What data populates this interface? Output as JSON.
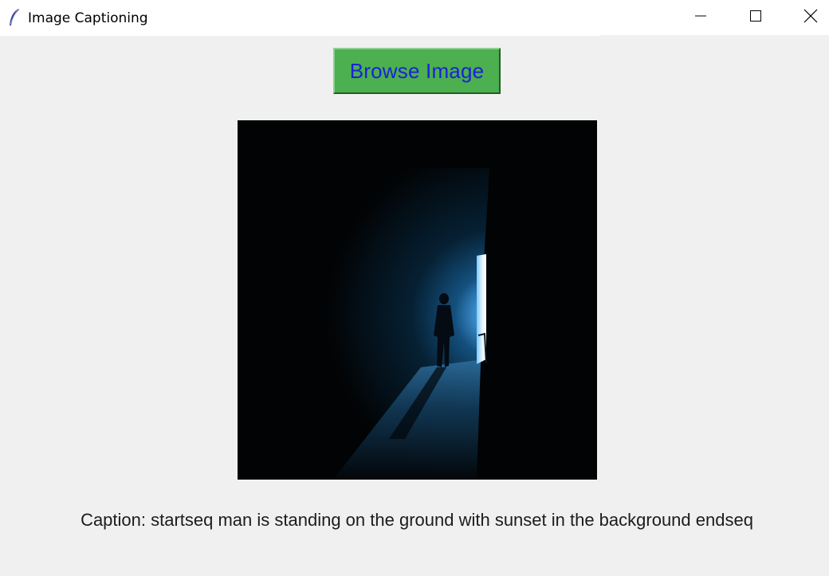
{
  "window": {
    "title": "Image Captioning",
    "icon": "feather-icon",
    "controls": [
      "minimize-icon",
      "maximize-icon",
      "close-icon"
    ]
  },
  "toolbar": {
    "browse_label": "Browse Image"
  },
  "image": {
    "description_icon": "photo-dark-corridor-silhouette"
  },
  "caption": {
    "text": "Caption: startseq man is standing on the ground with sunset in the background endseq"
  },
  "colors": {
    "button_bg": "#4caf50",
    "button_text": "#1a22d8",
    "window_bg": "#f0f0f0",
    "titlebar_bg": "#ffffff"
  }
}
